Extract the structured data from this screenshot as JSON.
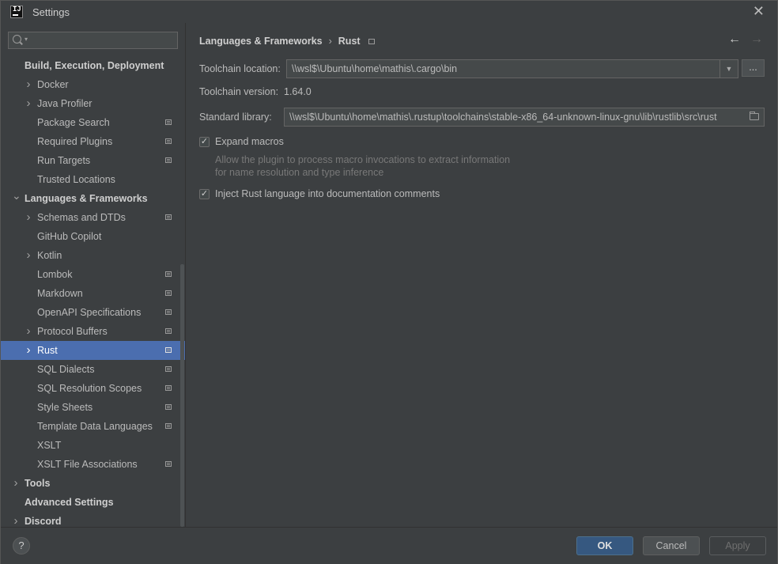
{
  "window": {
    "title": "Settings",
    "logo_text": "IJ"
  },
  "sidebar": {
    "search": {
      "value": "",
      "placeholder": ""
    },
    "items": [
      {
        "label": "Build, Execution, Deployment",
        "level": 0,
        "bold": true,
        "chevron": "",
        "project_icon": false
      },
      {
        "label": "Docker",
        "level": 1,
        "chevron": ">",
        "project_icon": false
      },
      {
        "label": "Java Profiler",
        "level": 1,
        "chevron": ">",
        "project_icon": false
      },
      {
        "label": "Package Search",
        "level": 1,
        "chevron": "",
        "project_icon": true
      },
      {
        "label": "Required Plugins",
        "level": 1,
        "chevron": "",
        "project_icon": true
      },
      {
        "label": "Run Targets",
        "level": 1,
        "chevron": "",
        "project_icon": true
      },
      {
        "label": "Trusted Locations",
        "level": 1,
        "chevron": "",
        "project_icon": false
      },
      {
        "label": "Languages & Frameworks",
        "level": 0,
        "bold": true,
        "chevron": "v",
        "project_icon": false
      },
      {
        "label": "Schemas and DTDs",
        "level": 1,
        "chevron": ">",
        "project_icon": true
      },
      {
        "label": "GitHub Copilot",
        "level": 1,
        "chevron": "",
        "project_icon": false
      },
      {
        "label": "Kotlin",
        "level": 1,
        "chevron": ">",
        "project_icon": false
      },
      {
        "label": "Lombok",
        "level": 1,
        "chevron": "",
        "project_icon": true
      },
      {
        "label": "Markdown",
        "level": 1,
        "chevron": "",
        "project_icon": true
      },
      {
        "label": "OpenAPI Specifications",
        "level": 1,
        "chevron": "",
        "project_icon": true
      },
      {
        "label": "Protocol Buffers",
        "level": 1,
        "chevron": ">",
        "project_icon": true
      },
      {
        "label": "Rust",
        "level": 1,
        "chevron": ">",
        "project_icon": true,
        "selected": true
      },
      {
        "label": "SQL Dialects",
        "level": 1,
        "chevron": "",
        "project_icon": true
      },
      {
        "label": "SQL Resolution Scopes",
        "level": 1,
        "chevron": "",
        "project_icon": true
      },
      {
        "label": "Style Sheets",
        "level": 1,
        "chevron": "",
        "project_icon": true
      },
      {
        "label": "Template Data Languages",
        "level": 1,
        "chevron": "",
        "project_icon": true
      },
      {
        "label": "XSLT",
        "level": 1,
        "chevron": "",
        "project_icon": false
      },
      {
        "label": "XSLT File Associations",
        "level": 1,
        "chevron": "",
        "project_icon": true
      },
      {
        "label": "Tools",
        "level": 0,
        "bold": true,
        "chevron": ">",
        "project_icon": false
      },
      {
        "label": "Advanced Settings",
        "level": 0,
        "bold": true,
        "chevron": "",
        "project_icon": false
      },
      {
        "label": "Discord",
        "level": 0,
        "bold": true,
        "chevron": ">",
        "project_icon": false
      }
    ]
  },
  "main": {
    "breadcrumb": [
      "Languages & Frameworks",
      "Rust"
    ],
    "toolchain_location": {
      "label": "Toolchain location:",
      "value": "\\\\wsl$\\Ubuntu\\home\\mathis\\.cargo\\bin",
      "browse_label": "..."
    },
    "toolchain_version": {
      "label": "Toolchain version:",
      "value": "1.64.0"
    },
    "standard_library": {
      "label": "Standard library:",
      "value": "\\\\wsl$\\Ubuntu\\home\\mathis\\.rustup\\toolchains\\stable-x86_64-unknown-linux-gnu\\lib\\rustlib\\src\\rust"
    },
    "expand_macros": {
      "label": "Expand macros",
      "checked": true,
      "hint_line1": "Allow the plugin to process macro invocations to extract information",
      "hint_line2": "for name resolution and type inference"
    },
    "inject_rust": {
      "label": "Inject Rust language into documentation comments",
      "checked": true
    }
  },
  "footer": {
    "help_label": "?",
    "ok_label": "OK",
    "cancel_label": "Cancel",
    "apply_label": "Apply"
  },
  "colors": {
    "background": "#3c3f41",
    "selection": "#4b6eaf",
    "ok_button": "#365880"
  }
}
